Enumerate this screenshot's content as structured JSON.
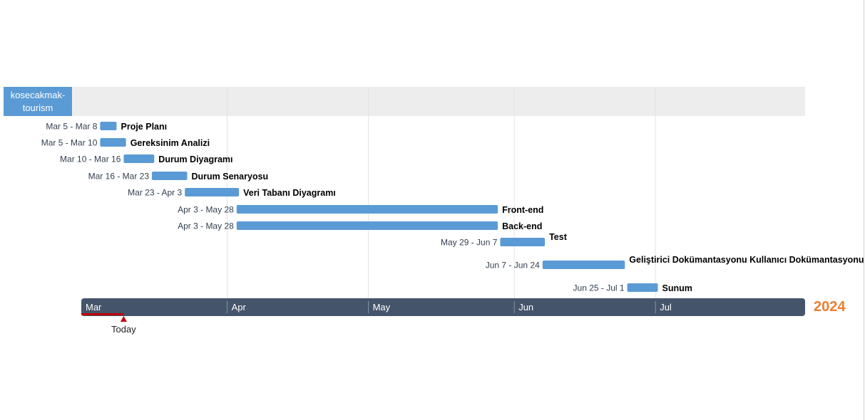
{
  "group": {
    "label": "kosecakmak-tourism"
  },
  "year_label": "2024",
  "chart_data": {
    "type": "gantt",
    "year": 2024,
    "colors": {
      "bar": "#5b9bd5",
      "timeline": "#44546a",
      "band": "#ededed",
      "today": "#c00000",
      "year": "#ed7d31"
    },
    "tasks": [
      {
        "name": "Proje Planı",
        "start": "2024-03-05",
        "end": "2024-03-08",
        "range_label": "Mar 5 - Mar 8"
      },
      {
        "name": "Gereksinim  Analizi",
        "start": "2024-03-05",
        "end": "2024-03-10",
        "range_label": "Mar 5 - Mar 10"
      },
      {
        "name": "Durum Diyagramı",
        "start": "2024-03-10",
        "end": "2024-03-16",
        "range_label": "Mar 10 - Mar 16"
      },
      {
        "name": "Durum Senaryosu",
        "start": "2024-03-16",
        "end": "2024-03-23",
        "range_label": "Mar 16 - Mar 23"
      },
      {
        "name": "Veri Tabanı Diyagramı",
        "start": "2024-03-23",
        "end": "2024-04-03",
        "range_label": "Mar 23 - Apr 3"
      },
      {
        "name": "Front-end",
        "start": "2024-04-03",
        "end": "2024-05-28",
        "range_label": "Apr 3 - May 28"
      },
      {
        "name": "Back-end",
        "start": "2024-04-03",
        "end": "2024-05-28",
        "range_label": "Apr 3 - May 28"
      },
      {
        "name": "Test",
        "start": "2024-05-29",
        "end": "2024-06-07",
        "range_label": "May 29 - Jun 7"
      },
      {
        "name": "Geliştirici Dokümantasyonu Kullanıcı Dokümantasyonu",
        "start": "2024-06-07",
        "end": "2024-06-24",
        "range_label": "Jun 7 - Jun 24"
      },
      {
        "name": "Sunum",
        "start": "2024-06-25",
        "end": "2024-07-01",
        "range_label": "Jun 25 - Jul 1"
      }
    ],
    "months": [
      {
        "label": "Mar",
        "start": "2024-03-01"
      },
      {
        "label": "Apr",
        "start": "2024-04-01"
      },
      {
        "label": "May",
        "start": "2024-05-01"
      },
      {
        "label": "Jun",
        "start": "2024-06-01"
      },
      {
        "label": "Jul",
        "start": "2024-07-01"
      }
    ],
    "axis_range": [
      "2024-03-01",
      "2024-07-31"
    ],
    "today": {
      "label": "Today",
      "date": "2024-03-10"
    }
  }
}
